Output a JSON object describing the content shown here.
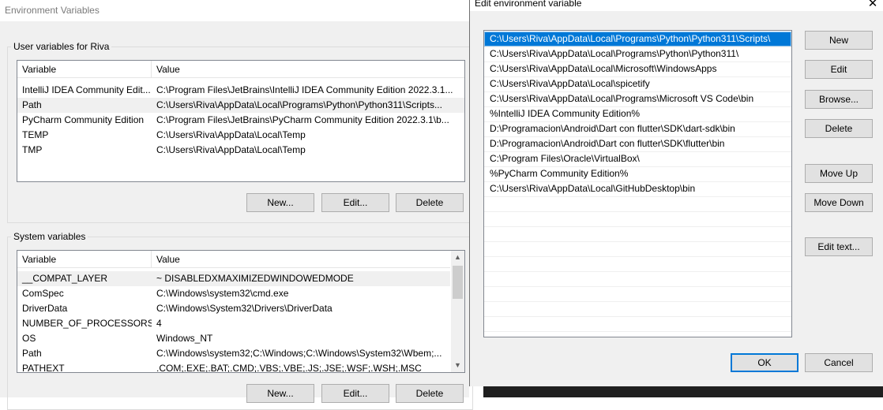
{
  "env_window": {
    "title": "Environment Variables",
    "user_group": {
      "label": "User variables for Riva",
      "columns": [
        "Variable",
        "Value"
      ],
      "rows": [
        {
          "variable": "IntelliJ IDEA Community Edit...",
          "value": "C:\\Program Files\\JetBrains\\IntelliJ IDEA Community Edition 2022.3.1..."
        },
        {
          "variable": "Path",
          "value": "C:\\Users\\Riva\\AppData\\Local\\Programs\\Python\\Python311\\Scripts..."
        },
        {
          "variable": "PyCharm Community Edition",
          "value": "C:\\Program Files\\JetBrains\\PyCharm Community Edition 2022.3.1\\b..."
        },
        {
          "variable": "TEMP",
          "value": "C:\\Users\\Riva\\AppData\\Local\\Temp"
        },
        {
          "variable": "TMP",
          "value": "C:\\Users\\Riva\\AppData\\Local\\Temp"
        }
      ],
      "selected_row": 1,
      "buttons": {
        "new": "New...",
        "edit": "Edit...",
        "delete": "Delete"
      }
    },
    "system_group": {
      "label": "System variables",
      "columns": [
        "Variable",
        "Value"
      ],
      "rows": [
        {
          "variable": "__COMPAT_LAYER",
          "value": "~ DISABLEDXMAXIMIZEDWINDOWEDMODE"
        },
        {
          "variable": "ComSpec",
          "value": "C:\\Windows\\system32\\cmd.exe"
        },
        {
          "variable": "DriverData",
          "value": "C:\\Windows\\System32\\Drivers\\DriverData"
        },
        {
          "variable": "NUMBER_OF_PROCESSORS",
          "value": "4"
        },
        {
          "variable": "OS",
          "value": "Windows_NT"
        },
        {
          "variable": "Path",
          "value": "C:\\Windows\\system32;C:\\Windows;C:\\Windows\\System32\\Wbem;..."
        },
        {
          "variable": "PATHEXT",
          "value": ".COM;.EXE;.BAT;.CMD;.VBS;.VBE;.JS;.JSE;.WSF;.WSH;.MSC"
        }
      ],
      "selected_row": 0,
      "buttons": {
        "new": "New...",
        "edit": "Edit...",
        "delete": "Delete"
      }
    }
  },
  "edit_dialog": {
    "title": "Edit environment variable",
    "close_glyph": "✕",
    "entries": [
      "C:\\Users\\Riva\\AppData\\Local\\Programs\\Python\\Python311\\Scripts\\",
      "C:\\Users\\Riva\\AppData\\Local\\Programs\\Python\\Python311\\",
      "C:\\Users\\Riva\\AppData\\Local\\Microsoft\\WindowsApps",
      "C:\\Users\\Riva\\AppData\\Local\\spicetify",
      "C:\\Users\\Riva\\AppData\\Local\\Programs\\Microsoft VS Code\\bin",
      "%IntelliJ IDEA Community Edition%",
      "D:\\Programacion\\Android\\Dart con flutter\\SDK\\dart-sdk\\bin",
      "D:\\Programacion\\Android\\Dart con flutter\\SDK\\flutter\\bin",
      "C:\\Program Files\\Oracle\\VirtualBox\\",
      "%PyCharm Community Edition%",
      "C:\\Users\\Riva\\AppData\\Local\\GitHubDesktop\\bin"
    ],
    "selected_entry": 0,
    "buttons": {
      "new": "New",
      "edit": "Edit",
      "browse": "Browse...",
      "delete": "Delete",
      "move_up": "Move Up",
      "move_down": "Move Down",
      "edit_text": "Edit text...",
      "ok": "OK",
      "cancel": "Cancel"
    }
  },
  "colors": {
    "selection": "#0078d7",
    "dialog_background": "#f0f0f0",
    "taskbar": "#1f1f1f"
  }
}
